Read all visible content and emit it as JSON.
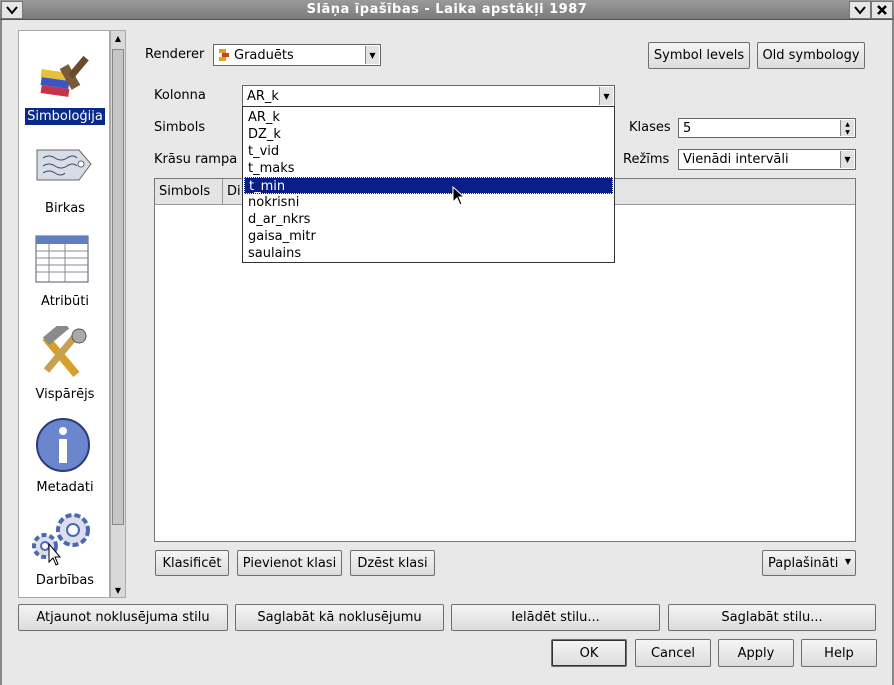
{
  "window": {
    "title": "Slāņa īpašības - Laika apstākļi 1987"
  },
  "sidebar": {
    "items": [
      {
        "label": "Simboloģija",
        "icon": "brush-icon",
        "selected": true
      },
      {
        "label": "Birkas",
        "icon": "tag-icon",
        "selected": false
      },
      {
        "label": "Atribūti",
        "icon": "table-icon",
        "selected": false
      },
      {
        "label": "Vispārējs",
        "icon": "tools-icon",
        "selected": false
      },
      {
        "label": "Metadati",
        "icon": "info-icon",
        "selected": false
      },
      {
        "label": "Darbības",
        "icon": "gears-icon",
        "selected": false
      }
    ]
  },
  "renderer": {
    "label": "Renderer",
    "value": "Graduēts"
  },
  "top_buttons": {
    "symbol_levels": "Symbol levels",
    "old_symbology": "Old symbology"
  },
  "form": {
    "kolonna_label": "Kolonna",
    "kolonna_value": "AR_k",
    "simbols_label": "Simbols",
    "krasu_rampa_label": "Krāsu rampa",
    "klases_label": "Klases",
    "klases_value": "5",
    "rezims_label": "Režīms",
    "rezims_value": "Vienādi intervāli"
  },
  "dropdown": {
    "options": [
      "AR_k",
      "DZ_k",
      "t_vid",
      "t_maks",
      "t_min",
      "nokrisni",
      "d_ar_nkrs",
      "gaisa_mitr",
      "saulains"
    ],
    "highlighted": "t_min"
  },
  "table": {
    "columns": [
      "Simbols",
      "Di"
    ]
  },
  "class_buttons": {
    "classify": "Klasificēt",
    "add_class": "Pievienot klasi",
    "delete_class": "Dzēst klasi",
    "advanced": "Paplašināti"
  },
  "style_buttons": {
    "restore_default": "Atjaunot noklusējuma stilu",
    "save_default": "Saglabāt kā noklusējumu",
    "load_style": "Ielādēt stilu...",
    "save_style": "Saglabāt stilu..."
  },
  "dialog_buttons": {
    "ok": "OK",
    "cancel": "Cancel",
    "apply": "Apply",
    "help": "Help"
  },
  "colors": {
    "selection": "#0a1e8a",
    "titlebar": "#8a8a8a"
  }
}
